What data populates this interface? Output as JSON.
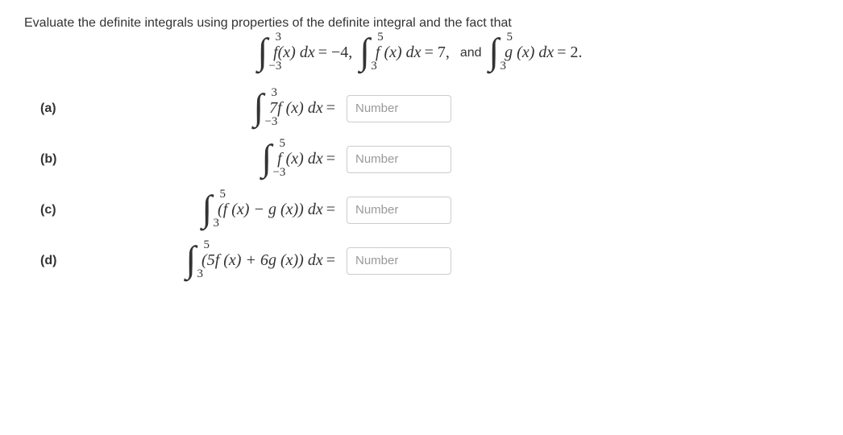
{
  "instruction": "Evaluate the definite integrals using properties of the definite integral and the fact that",
  "given": {
    "int1": {
      "lower": "−3",
      "upper": "3",
      "body": "f(x)",
      "dx": "dx",
      "eq": "= −4,",
      "value": -4
    },
    "int2": {
      "lower": "3",
      "upper": "5",
      "body": "f (x)",
      "dx": "dx",
      "eq": "= 7,",
      "value": 7
    },
    "and": "and",
    "int3": {
      "lower": "3",
      "upper": "5",
      "body": "g (x)",
      "dx": "dx",
      "eq": "= 2.",
      "value": 2
    }
  },
  "parts": {
    "a": {
      "label": "(a)",
      "lower": "−3",
      "upper": "3",
      "body": "7f (x)",
      "dx": "dx",
      "eq": "="
    },
    "b": {
      "label": "(b)",
      "lower": "−3",
      "upper": "5",
      "body": "f (x)",
      "dx": "dx",
      "eq": "="
    },
    "c": {
      "label": "(c)",
      "lower": "3",
      "upper": "5",
      "body": "(f (x) − g (x))",
      "dx": "dx",
      "eq": "="
    },
    "d": {
      "label": "(d)",
      "lower": "3",
      "upper": "5",
      "body": "(5f (x) + 6g (x))",
      "dx": "dx",
      "eq": "="
    }
  },
  "placeholder": "Number"
}
